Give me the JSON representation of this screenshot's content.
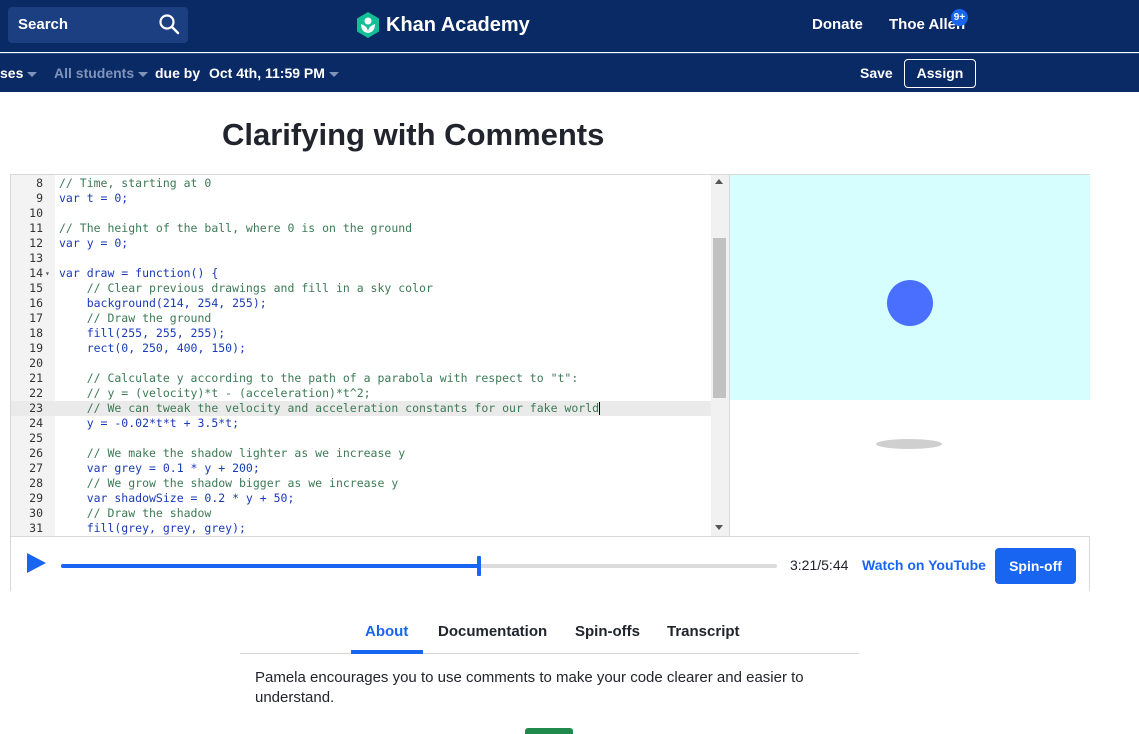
{
  "header": {
    "search_label": "Search",
    "logo_text": "Khan Academy",
    "donate_label": "Donate",
    "user_name": "Thoe Allen",
    "notification_badge": "9+"
  },
  "subbar": {
    "courses_label": "ses",
    "students_label": "All students",
    "due_by_label": "due by",
    "due_date": "Oct 4th, 11:59 PM",
    "save_label": "Save",
    "assign_label": "Assign"
  },
  "page": {
    "title": "Clarifying with Comments"
  },
  "editor": {
    "active_line": 23,
    "lines": [
      {
        "n": "8",
        "t": "// Time, starting at 0",
        "c": true
      },
      {
        "n": "9",
        "t": "var t = 0;",
        "c": false
      },
      {
        "n": "10",
        "t": "",
        "c": false
      },
      {
        "n": "11",
        "t": "// The height of the ball, where 0 is on the ground",
        "c": true
      },
      {
        "n": "12",
        "t": "var y = 0;",
        "c": false
      },
      {
        "n": "13",
        "t": "",
        "c": false
      },
      {
        "n": "14",
        "t": "var draw = function() {",
        "c": false,
        "fold": true
      },
      {
        "n": "15",
        "t": "    // Clear previous drawings and fill in a sky color",
        "c": true
      },
      {
        "n": "16",
        "t": "    background(214, 254, 255);",
        "c": false
      },
      {
        "n": "17",
        "t": "    // Draw the ground",
        "c": true
      },
      {
        "n": "18",
        "t": "    fill(255, 255, 255);",
        "c": false
      },
      {
        "n": "19",
        "t": "    rect(0, 250, 400, 150);",
        "c": false
      },
      {
        "n": "20",
        "t": "",
        "c": false
      },
      {
        "n": "21",
        "t": "    // Calculate y according to the path of a parabola with respect to \"t\":",
        "c": true
      },
      {
        "n": "22",
        "t": "    // y = (velocity)*t - (acceleration)*t^2;",
        "c": true
      },
      {
        "n": "23",
        "t": "    // We can tweak the velocity and acceleration constants for our fake world",
        "c": true,
        "cursor": true
      },
      {
        "n": "24",
        "t": "    y = -0.02*t*t + 3.5*t;",
        "c": false
      },
      {
        "n": "25",
        "t": "",
        "c": false
      },
      {
        "n": "26",
        "t": "    // We make the shadow lighter as we increase y",
        "c": true
      },
      {
        "n": "27",
        "t": "    var grey = 0.1 * y + 200;",
        "c": false
      },
      {
        "n": "28",
        "t": "    // We grow the shadow bigger as we increase y",
        "c": true
      },
      {
        "n": "29",
        "t": "    var shadowSize = 0.2 * y + 50;",
        "c": false
      },
      {
        "n": "30",
        "t": "    // Draw the shadow",
        "c": true
      },
      {
        "n": "31",
        "t": "    fill(grey, grey, grey);",
        "c": false
      }
    ]
  },
  "canvas": {
    "sky_color": "#d6feff",
    "ground_color": "#ffffff",
    "ball_color": "#4a6fff",
    "shadow_color": "#cfcfcf"
  },
  "player": {
    "current_time": "3:21",
    "total_time": "5:44",
    "progress_fraction": 0.584,
    "youtube_label": "Watch on YouTube",
    "spinoff_label": "Spin-off"
  },
  "tabs": {
    "about": "About",
    "documentation": "Documentation",
    "spinoffs": "Spin-offs",
    "transcript": "Transcript"
  },
  "about_text": "Pamela encourages you to use comments to make your code clearer and easier to understand."
}
